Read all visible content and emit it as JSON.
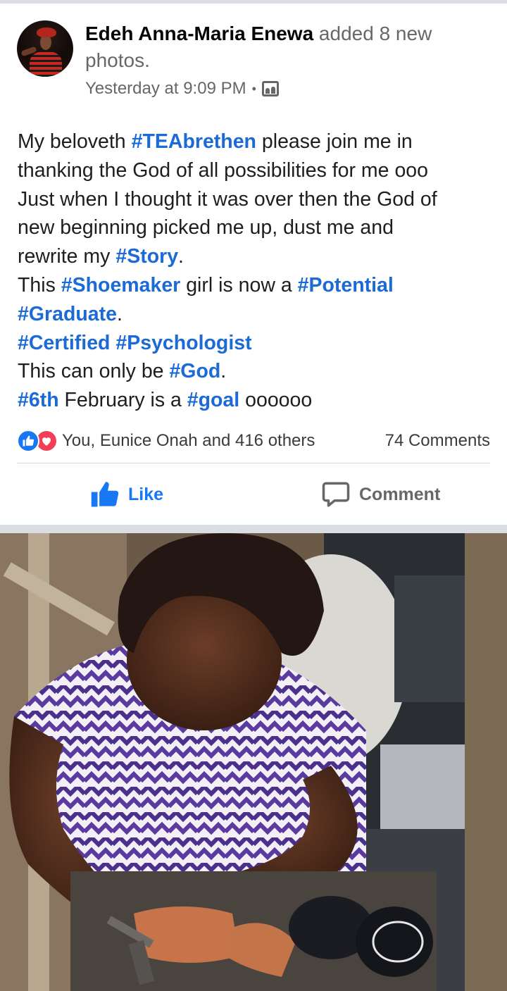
{
  "header": {
    "author_name": "Edeh Anna-Maria Enewa",
    "action_text": " added 8 new photos.",
    "timestamp": "Yesterday at 9:09 PM",
    "separator": "•",
    "privacy_icon": "photo-album-icon"
  },
  "post": {
    "lines": [
      [
        {
          "t": "My beloveth "
        },
        {
          "t": "#TEAbrethen",
          "tag": true
        },
        {
          "t": " please join me in"
        }
      ],
      [
        {
          "t": "thanking the God of all possibilities for me ooo"
        }
      ],
      [
        {
          "t": "Just when I thought it was over then the God of"
        }
      ],
      [
        {
          "t": "new beginning picked me up, dust me and"
        }
      ],
      [
        {
          "t": "rewrite my "
        },
        {
          "t": "#Story",
          "tag": true
        },
        {
          "t": "."
        }
      ],
      [
        {
          "t": "This "
        },
        {
          "t": "#Shoemaker",
          "tag": true
        },
        {
          "t": " girl is now a "
        },
        {
          "t": "#Potential",
          "tag": true
        }
      ],
      [
        {
          "t": "#Graduate",
          "tag": true
        },
        {
          "t": "."
        }
      ],
      [
        {
          "t": "#Certified",
          "tag": true
        },
        {
          "t": " "
        },
        {
          "t": "#Psychologist",
          "tag": true
        }
      ],
      [
        {
          "t": "This can only be "
        },
        {
          "t": "#God",
          "tag": true
        },
        {
          "t": "."
        }
      ],
      [
        {
          "t": "#6th",
          "tag": true
        },
        {
          "t": " February is a "
        },
        {
          "t": "#goal",
          "tag": true
        },
        {
          "t": " oooooo"
        }
      ]
    ]
  },
  "reactions": {
    "icons": [
      "like-reaction-icon",
      "love-reaction-icon"
    ],
    "summary": "You, Eunice Onah and 416 others",
    "comments": "74 Comments"
  },
  "actions": {
    "like_label": "Like",
    "comment_label": "Comment"
  },
  "colors": {
    "hashtag": "#1b6ad6",
    "like_active": "#1877f2",
    "love": "#f33e58",
    "secondary_text": "#65676b",
    "separator": "#dadde1"
  }
}
